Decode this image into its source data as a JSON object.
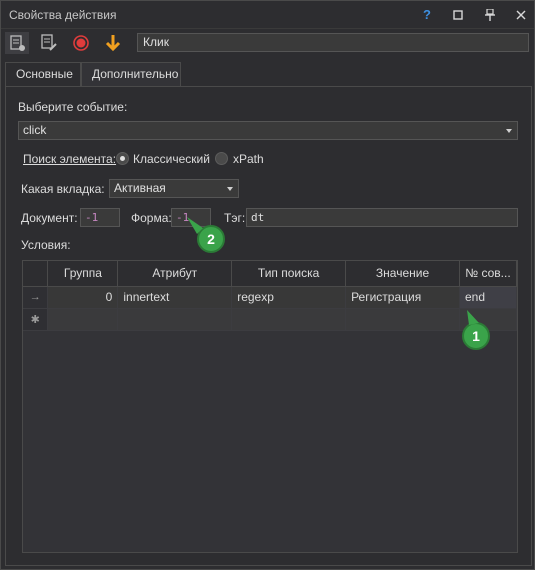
{
  "window": {
    "title": "Свойства действия"
  },
  "titlebar": {
    "help": "?",
    "maximize": "□",
    "pin": "⊥",
    "close": "✕"
  },
  "toolbar": {
    "name_value": "Клик"
  },
  "tabs": [
    {
      "label": "Основные",
      "active": true
    },
    {
      "label": "Дополнительно",
      "active": false
    }
  ],
  "event": {
    "label": "Выберите событие:",
    "value": "click"
  },
  "search": {
    "label": "Поиск элемента:",
    "option_classic": "Классический",
    "option_xpath": "xPath",
    "selected": "Классический"
  },
  "tab_select": {
    "label": "Какая вкладка:",
    "value": "Активная"
  },
  "document": {
    "label": "Документ:",
    "value": "-1"
  },
  "form": {
    "label": "Форма:",
    "value": "-1"
  },
  "tag": {
    "label": "Тэг:",
    "value": "dt"
  },
  "conditions": {
    "label": "Условия:",
    "columns": [
      "Группа",
      "Атрибут",
      "Тип поиска",
      "Значение",
      "№ сов..."
    ],
    "rows": [
      {
        "marker": "→",
        "group": "0",
        "attribute": "innertext",
        "search_type": "regexp",
        "value": "Регистрация",
        "match": "end"
      }
    ],
    "new_row_marker": "✱"
  },
  "callouts": {
    "one": "1",
    "two": "2"
  },
  "colors": {
    "accent_green": "#3aa34a",
    "help_blue": "#3d8fe0",
    "record_red": "#e03c3c",
    "arrow_orange": "#f0a020"
  },
  "icons": [
    "properties-icon",
    "edit-icon",
    "record-icon",
    "download-arrow-icon",
    "help-icon",
    "maximize-icon",
    "pin-icon",
    "close-icon"
  ]
}
